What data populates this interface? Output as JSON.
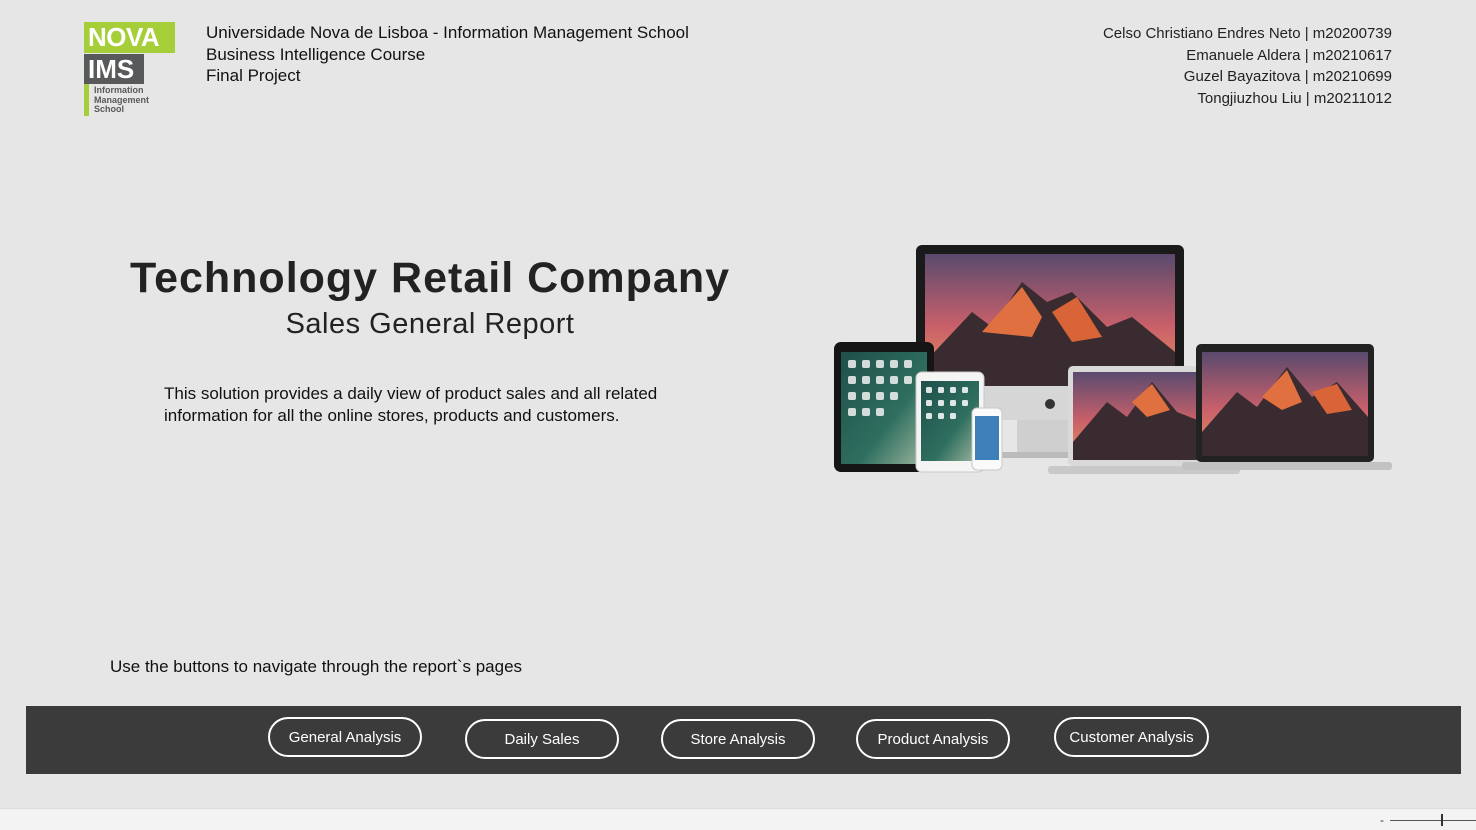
{
  "logo": {
    "line1": "NOVA",
    "line2": "IMS",
    "sub1": "Information",
    "sub2": "Management",
    "sub3": "School"
  },
  "header": {
    "left": [
      "Universidade Nova de Lisboa - Information Management School",
      "Business Intelligence Course",
      "Final Project"
    ],
    "authors": [
      "Celso Christiano Endres Neto | m20200739",
      "Emanuele Aldera | m20210617",
      "Guzel Bayazitova | m20210699",
      "Tongjiuzhou Liu | m20211012"
    ]
  },
  "main": {
    "title": "Technology Retail Company",
    "subtitle": "Sales General Report",
    "description_line1": "This solution provides a daily view of product sales and all related",
    "description_line2": "information for all the online stores, products and customers."
  },
  "nav": {
    "hint": "Use the buttons to navigate through the report`s pages",
    "buttons": [
      "General Analysis",
      "Daily Sales",
      "Store Analysis",
      "Product Analysis",
      "Customer Analysis"
    ]
  },
  "status": {
    "zoom_minus": "-"
  },
  "colors": {
    "background": "#e6e6e6",
    "nav_bar": "#3b3b3b",
    "nova_green": "#a6ce39",
    "ims_gray": "#58595b"
  }
}
